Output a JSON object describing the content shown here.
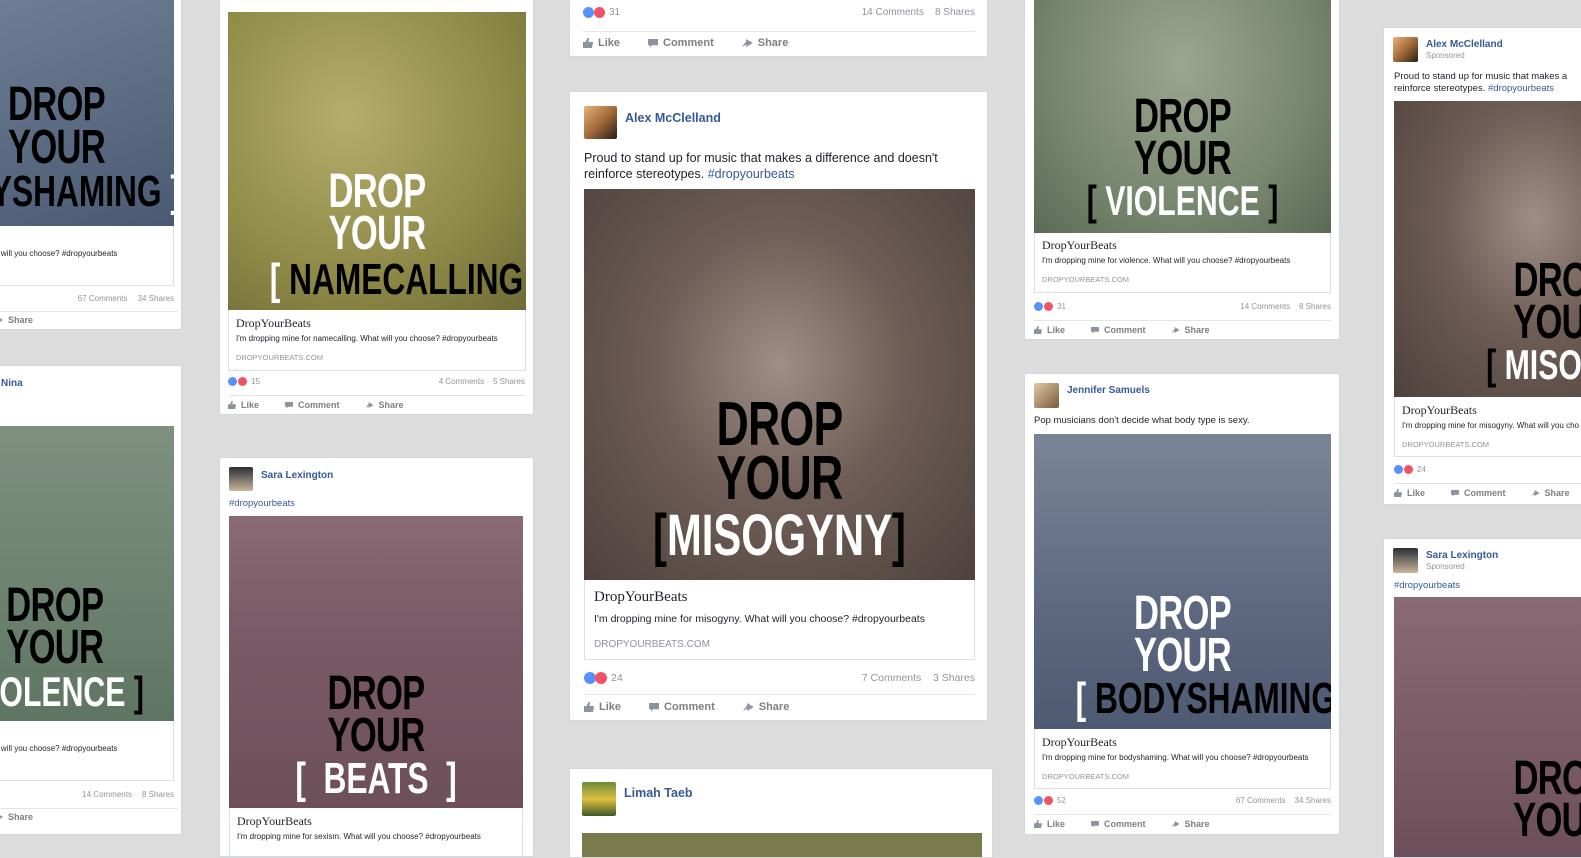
{
  "posts": {
    "c1": {
      "stats": {
        "comments": "67 Comments",
        "shares": "34 Shares"
      },
      "desc": "at will you choose? #dropyourbeats",
      "word": "YSHAMING",
      "drop": "DROP",
      "your": "YOUR"
    },
    "c2": {
      "stats": {
        "comments": "14 Comments",
        "shares": "8 Shares"
      },
      "desc": "at will you choose? #dropyourbeats",
      "word": "OLENCE",
      "drop": "DROP",
      "your": "YOUR",
      "name": "Nina"
    },
    "c3": {
      "word": "NAMECALLING",
      "drop": "DROP",
      "your": "YOUR",
      "title": "DropYourBeats",
      "desc": "I'm dropping mine for namecalling. What will you choose? #dropyourbeats",
      "url": "DROPYOURBEATS.COM",
      "reactions": "15",
      "comments": "4 Comments",
      "shares": "5 Shares"
    },
    "c4": {
      "name": "Sara Lexington",
      "caption": "#dropyourbeats",
      "word": "BEATS",
      "drop": "DROP",
      "your": "YOUR",
      "title": "DropYourBeats",
      "desc": "I'm dropping mine for sexism. What will you choose? #dropyourbeats"
    },
    "c5": {
      "reactions": "31",
      "comments": "14 Comments",
      "shares": "8 Shares"
    },
    "c6": {
      "name": "Alex McClelland",
      "caption": "Proud to stand up for music that makes a difference and doesn't reinforce stereotypes.",
      "hashtag": "#dropyourbeats",
      "word": "MISOGYNY",
      "drop": "DROP",
      "your": "YOUR",
      "title": "DropYourBeats",
      "desc": "I'm dropping mine for misogyny. What will you choose? #dropyourbeats",
      "url": "DROPYOURBEATS.COM",
      "reactions": "24",
      "comments": "7 Comments",
      "shares": "3 Shares"
    },
    "c7": {
      "name": "Limah Taeb"
    },
    "c8": {
      "word": "VIOLENCE",
      "drop": "DROP",
      "your": "YOUR",
      "title": "DropYourBeats",
      "desc": "I'm dropping mine for violence. What will you choose? #dropyourbeats",
      "url": "DROPYOURBEATS.COM",
      "reactions": "31",
      "comments": "14 Comments",
      "shares": "8 Shares"
    },
    "c9": {
      "name": "Jennifer Samuels",
      "caption": "Pop musicians don't decide what body type is sexy.",
      "word": "BODYSHAMING",
      "drop": "DROP",
      "your": "YOUR",
      "title": "DropYourBeats",
      "desc": "I'm dropping mine for bodyshaming. What will you choose? #dropyourbeats",
      "url": "DROPYOURBEATS.COM",
      "reactions": "52",
      "comments": "67 Comments",
      "shares": "34 Shares"
    },
    "c10": {
      "name": "Alex McClelland",
      "sponsored": "Sponsored",
      "caption": "Proud to stand up for music that makes a",
      "caption2": "reinforce stereotypes.",
      "hashtag": "#dropyourbeats",
      "word": "MISOGY",
      "drop": "DRO",
      "your": "YOU",
      "title": "DropYourBeats",
      "desc": "I'm dropping mine for misogyny. What will you cho",
      "url": "DROPYOURBEATS.COM",
      "reactions": "24"
    },
    "c11": {
      "name": "Sara Lexington",
      "sponsored": "Sponsored",
      "caption": "#dropyourbeats",
      "drop": "DRO",
      "your": "YOU"
    }
  },
  "actions": {
    "like": "Like",
    "comment": "Comment",
    "share": "Share"
  },
  "colors": {
    "link": "#365899",
    "like": "#5890ff",
    "love": "#f25268"
  }
}
